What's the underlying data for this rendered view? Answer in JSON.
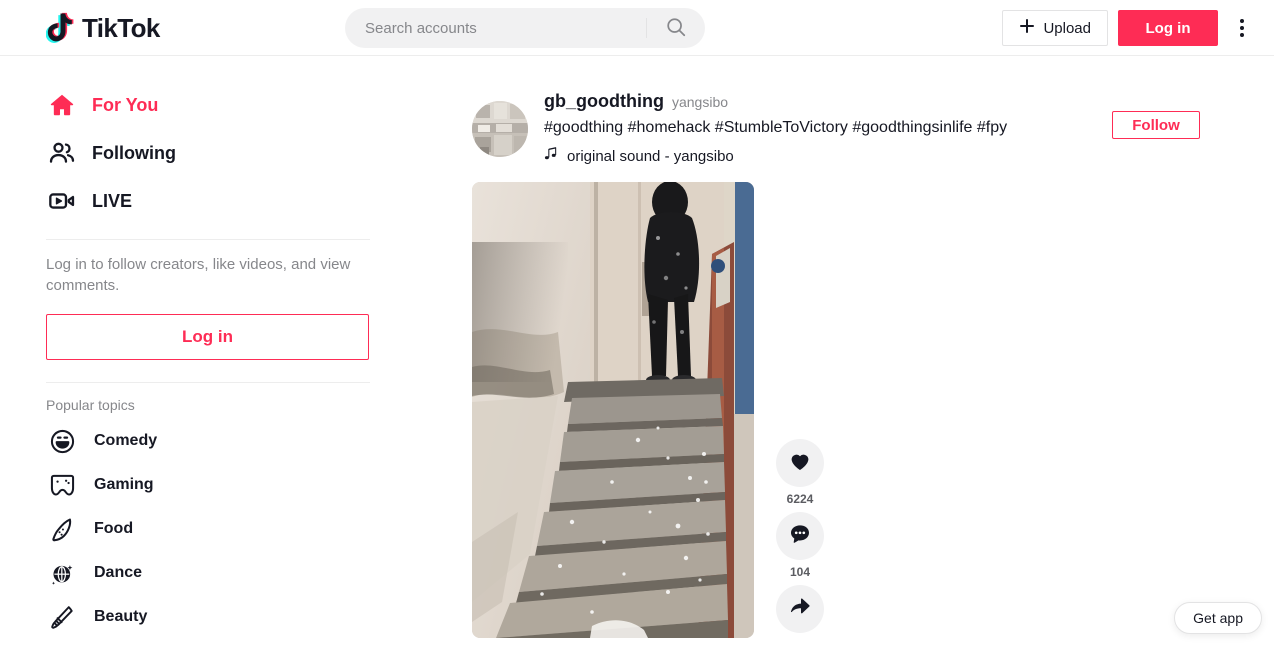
{
  "header": {
    "logo_text": "TikTok",
    "logo_icon": "tiktok-note-icon",
    "search": {
      "placeholder": "Search accounts",
      "value": "",
      "icon": "search-icon"
    },
    "upload_label": "Upload",
    "upload_icon": "plus-icon",
    "login_label": "Log in",
    "more_icon": "kebab-menu-icon"
  },
  "sidebar": {
    "nav": [
      {
        "label": "For You",
        "icon": "home-icon",
        "active": true
      },
      {
        "label": "Following",
        "icon": "people-icon",
        "active": false
      },
      {
        "label": "LIVE",
        "icon": "live-video-icon",
        "active": false
      }
    ],
    "login_prompt": "Log in to follow creators, like videos, and view comments.",
    "login_label": "Log in",
    "popular_topics_title": "Popular topics",
    "topics": [
      {
        "label": "Comedy",
        "icon": "smiley-face-icon"
      },
      {
        "label": "Gaming",
        "icon": "gamepad-icon"
      },
      {
        "label": "Food",
        "icon": "pizza-slice-icon"
      },
      {
        "label": "Dance",
        "icon": "disco-ball-icon"
      },
      {
        "label": "Beauty",
        "icon": "makeup-brush-icon"
      }
    ]
  },
  "post": {
    "author": "gb_goodthing",
    "nickname": "yangsibo",
    "caption": "#goodthing #homehack #StumbleToVictory #goodthingsinlife #fpy",
    "music_icon": "music-note-icon",
    "music": "original sound - yangsibo",
    "follow_label": "Follow",
    "avatar_alt": "kitchen-avatar",
    "video_alt": "snowy-concrete-stairwell-with-person-in-dark-winter-coat",
    "actions": [
      {
        "name": "like",
        "icon": "heart-icon",
        "count": "6224"
      },
      {
        "name": "comment",
        "icon": "speech-bubble-icon",
        "count": "104"
      },
      {
        "name": "share",
        "icon": "share-arrow-icon",
        "count": ""
      }
    ]
  },
  "floating": {
    "get_app_label": "Get app"
  },
  "colors": {
    "accent": "#fe2c55",
    "cyan": "#25f4ee",
    "text": "#161823",
    "muted": "#86878b",
    "surface": "#f1f1f2",
    "border": "#ededed"
  }
}
